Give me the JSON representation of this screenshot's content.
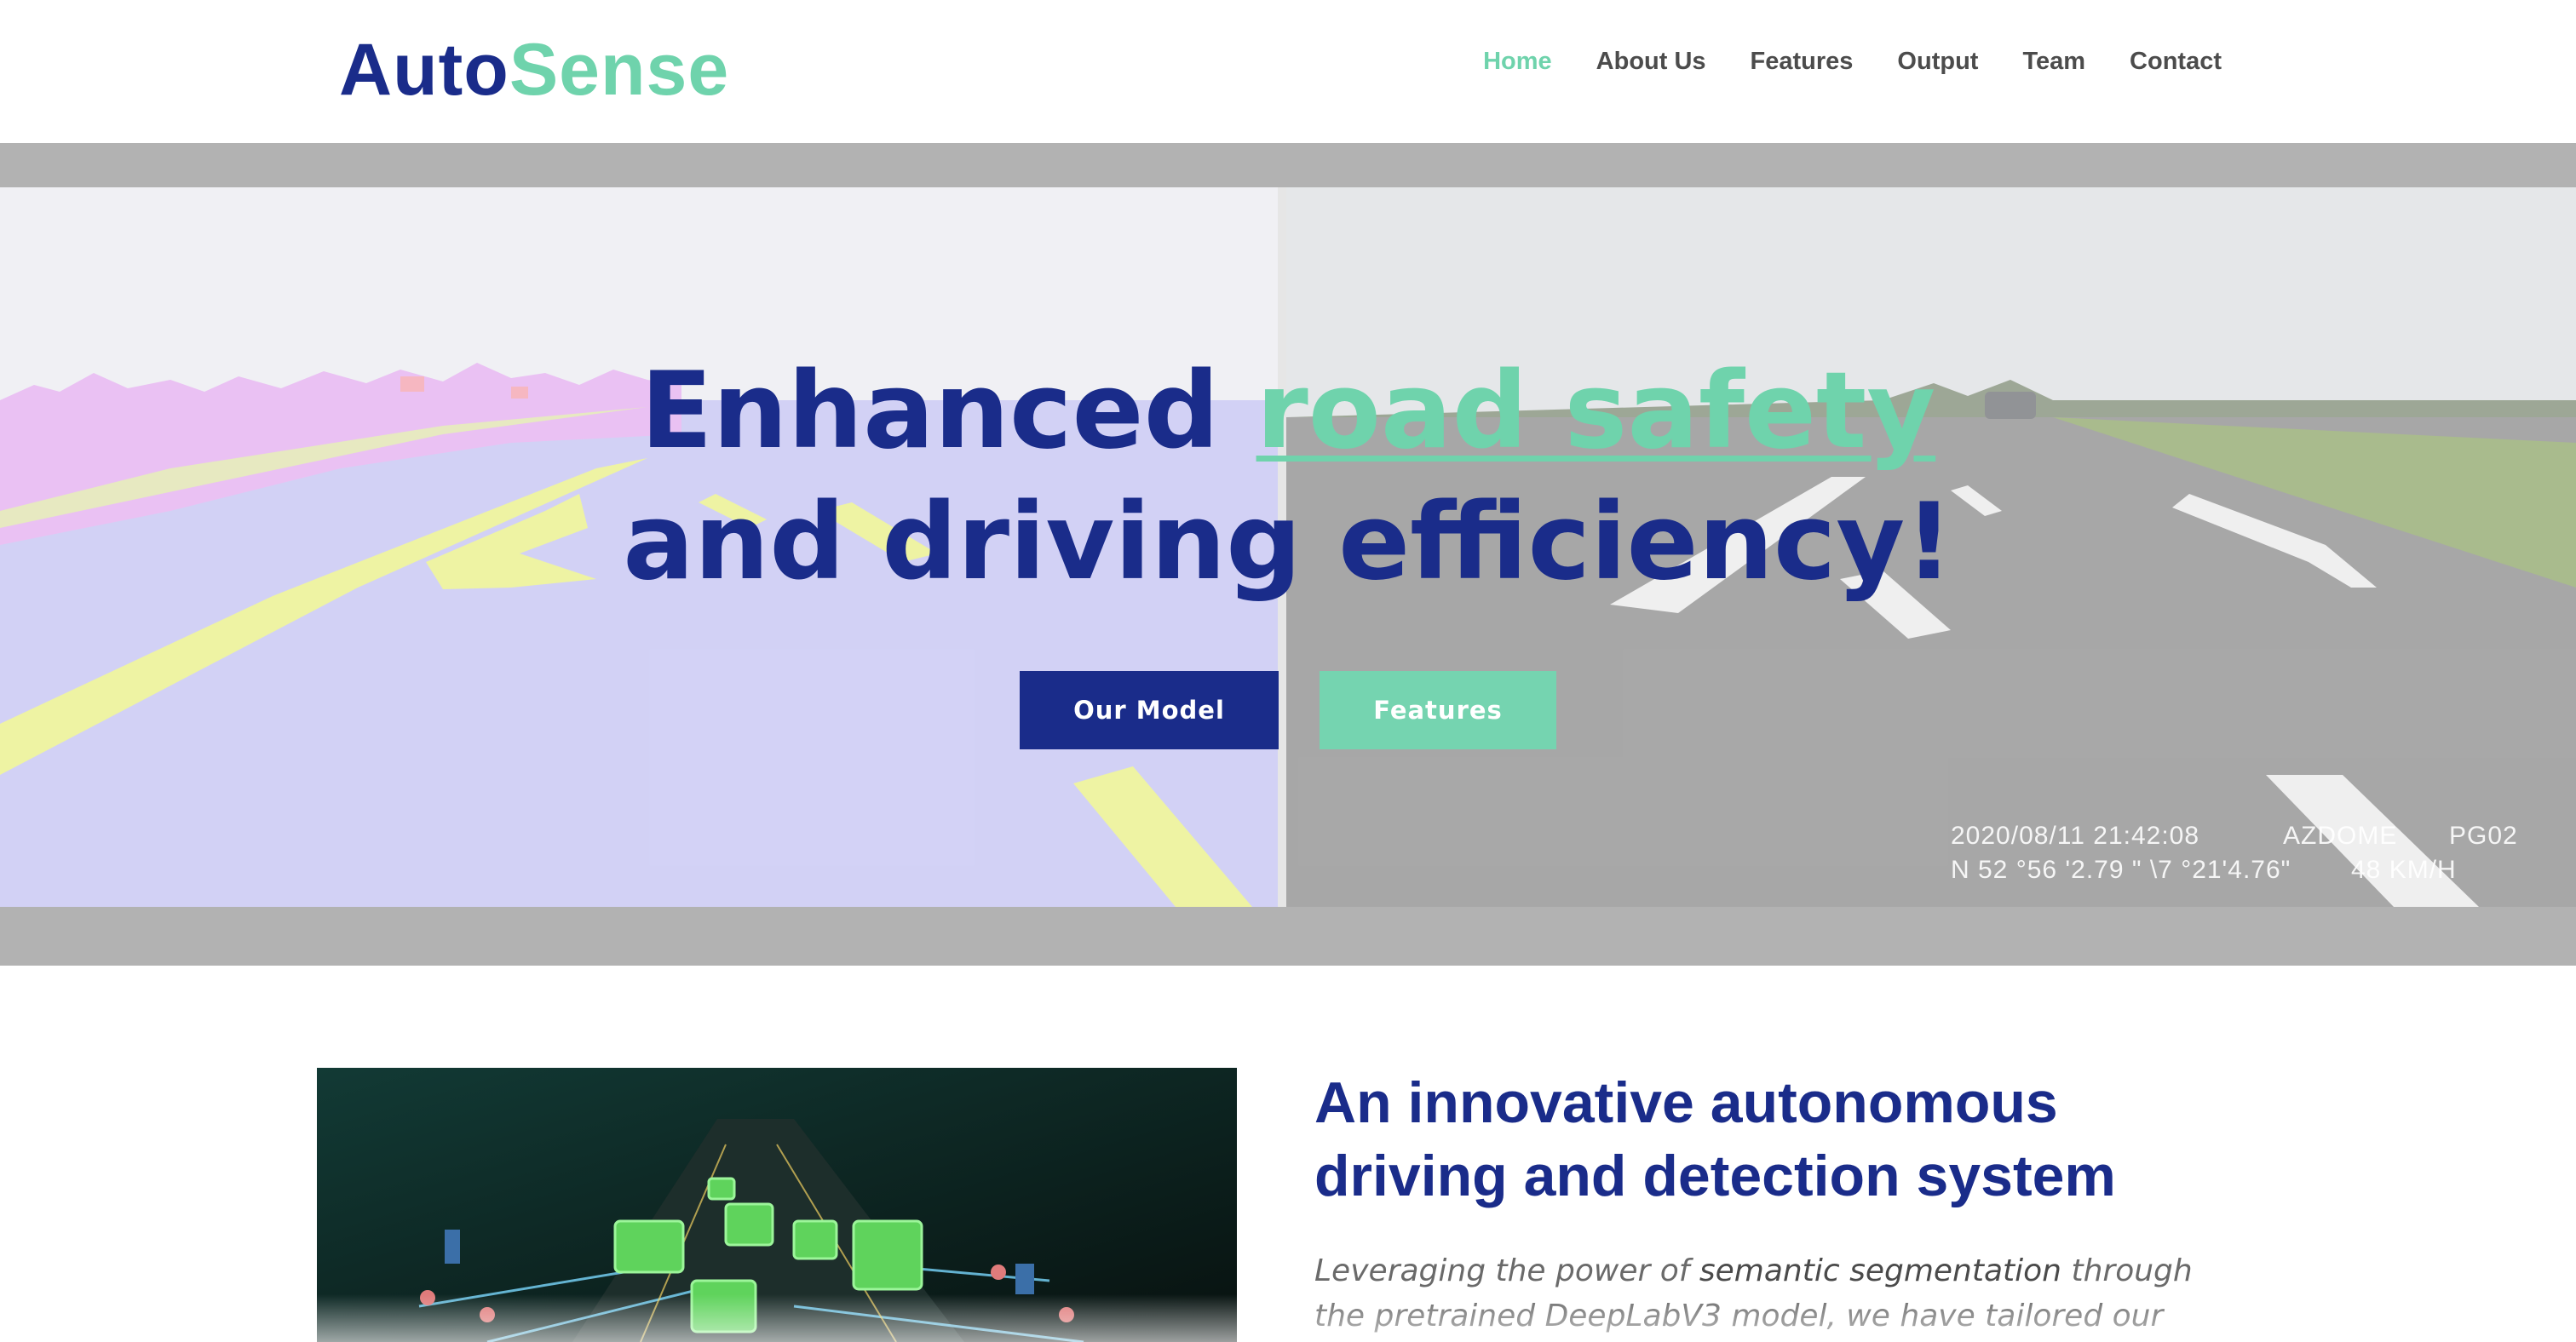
{
  "header": {
    "logo": {
      "part1": "Auto",
      "part2": "Sense"
    },
    "nav": [
      {
        "label": "Home",
        "active": true
      },
      {
        "label": "About Us"
      },
      {
        "label": "Features"
      },
      {
        "label": "Output"
      },
      {
        "label": "Team"
      },
      {
        "label": "Contact"
      }
    ]
  },
  "hero": {
    "title_part1": "Enhanced ",
    "title_highlight": "road safety",
    "title_part2": "and driving efficiency!",
    "buttons": {
      "primary": "Our Model",
      "secondary": "Features"
    },
    "dashcam": {
      "datetime": "2020/08/11 21:42:08",
      "brand": "AZDOME",
      "code": "PG02",
      "coords": "N 52 °56 '2.79 \" \\7     °21'4.76\"",
      "speed": "48  KM/H"
    }
  },
  "intro": {
    "title": "An innovative autonomous driving and detection system",
    "text_a": "Leveraging the power of ",
    "text_em": "semantic segmentation",
    "text_b": " through the pretrained DeepLabV3 model, we have tailored our"
  },
  "colors": {
    "brand_navy": "#1a2c8a",
    "brand_mint": "#6fd3ac",
    "nav_text": "#4c4c4c",
    "hero_frame": "#b2b2b2"
  },
  "icons": []
}
